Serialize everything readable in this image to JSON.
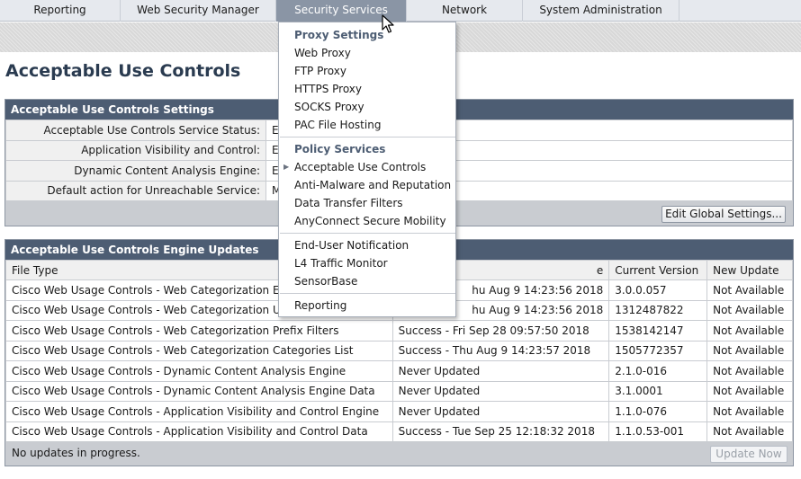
{
  "nav": {
    "tabs": [
      "Reporting",
      "Web Security Manager",
      "Security Services",
      "Network",
      "System Administration"
    ],
    "active": "Security Services"
  },
  "page_title": "Acceptable Use Controls",
  "settings_panel": {
    "title": "Acceptable Use Controls Settings",
    "rows": [
      {
        "label": "Acceptable Use Controls Service Status:",
        "value": "E"
      },
      {
        "label": "Application Visibility and Control:",
        "value": "E"
      },
      {
        "label": "Dynamic Content Analysis Engine:",
        "value": "E"
      },
      {
        "label": "Default action for Unreachable Service:",
        "value": "M"
      }
    ],
    "edit_button": "Edit Global Settings..."
  },
  "updates_panel": {
    "title": "Acceptable Use Controls Engine Updates",
    "columns": [
      "File Type",
      "e",
      "Current Version",
      "New Update"
    ],
    "rows": [
      {
        "file_type": "Cisco Web Usage Controls - Web Categorization Engi",
        "last_update": "hu Aug 9 14:23:56 2018",
        "version": "3.0.0.057",
        "new_update": "Not Available"
      },
      {
        "file_type": "Cisco Web Usage Controls - Web Categorization URL",
        "last_update": "hu Aug 9 14:23:56 2018",
        "version": "1312487822",
        "new_update": "Not Available"
      },
      {
        "file_type": "Cisco Web Usage Controls - Web Categorization Prefix Filters",
        "last_update": "Success - Fri Sep 28 09:57:50 2018",
        "version": "1538142147",
        "new_update": "Not Available"
      },
      {
        "file_type": "Cisco Web Usage Controls - Web Categorization Categories List",
        "last_update": "Success - Thu Aug 9 14:23:57 2018",
        "version": "1505772357",
        "new_update": "Not Available"
      },
      {
        "file_type": "Cisco Web Usage Controls - Dynamic Content Analysis Engine",
        "last_update": "Never Updated",
        "version": "2.1.0-016",
        "new_update": "Not Available"
      },
      {
        "file_type": "Cisco Web Usage Controls - Dynamic Content Analysis Engine Data",
        "last_update": "Never Updated",
        "version": "3.1.0001",
        "new_update": "Not Available"
      },
      {
        "file_type": "Cisco Web Usage Controls - Application Visibility and Control Engine",
        "last_update": "Never Updated",
        "version": "1.1.0-076",
        "new_update": "Not Available"
      },
      {
        "file_type": "Cisco Web Usage Controls - Application Visibility and Control Data",
        "last_update": "Success - Tue Sep 25 12:18:32 2018",
        "version": "1.1.0.53-001",
        "new_update": "Not Available"
      }
    ],
    "status": "No updates in progress.",
    "update_button": "Update Now"
  },
  "menu": {
    "proxy_heading": "Proxy Settings",
    "proxy_items": [
      "Web Proxy",
      "FTP Proxy",
      "HTTPS Proxy",
      "SOCKS Proxy",
      "PAC File Hosting"
    ],
    "policy_heading": "Policy Services",
    "policy_items": [
      "Acceptable Use Controls",
      "Anti-Malware and Reputation",
      "Data Transfer Filters",
      "AnyConnect Secure Mobility"
    ],
    "other_items": [
      "End-User Notification",
      "L4 Traffic Monitor",
      "SensorBase"
    ],
    "last_items": [
      "Reporting"
    ]
  },
  "icons": {
    "menu_pointer": "triangle-right-icon",
    "cursor": "mouse-pointer-icon"
  },
  "colors": {
    "panel_header": "#4d5d73",
    "active_tab": "#8a95a5",
    "title": "#2a3b50"
  }
}
